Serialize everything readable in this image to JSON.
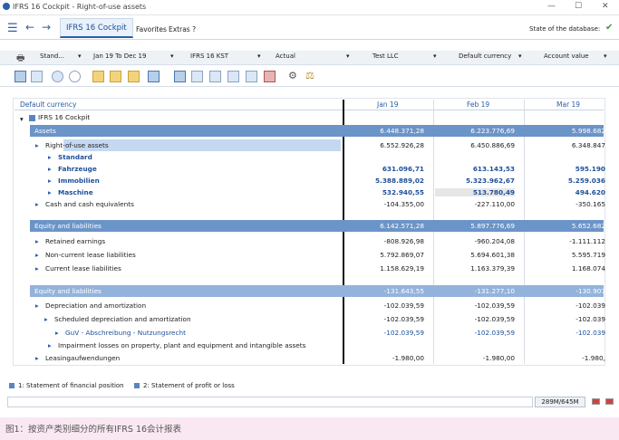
{
  "window": {
    "title": "IFRS 16 Cockpit - Right-of-use assets"
  },
  "menu": {
    "tab": "IFRS 16 Cockpit",
    "favorites": "Favorites",
    "extras": "Extras ?",
    "db_state": "State of the database:"
  },
  "params": [
    "Stand...",
    "Jan 19 To Dec 19",
    "IFRS 16 KST",
    "Actual",
    "Test LLC",
    "Default currency",
    "Account value"
  ],
  "grid": {
    "header": "Default currency",
    "columns": [
      "Jan 19",
      "Feb 19",
      "Mar 19"
    ],
    "root": "IFRS 16 Cockpit",
    "rows": [
      {
        "id": "assets",
        "label": "Assets",
        "values": [
          "6.448.371,28",
          "6.223.776,69",
          "5.998.682"
        ],
        "style": "band"
      },
      {
        "id": "rou",
        "label": "Right-of-use assets",
        "values": [
          "6.552.926,28",
          "6.450.886,69",
          "6.348.847"
        ],
        "style": "sel"
      },
      {
        "id": "standard",
        "label": "Standard",
        "values": [
          "",
          "",
          ""
        ],
        "style": "b"
      },
      {
        "id": "fahrzeuge",
        "label": "Fahrzeuge",
        "values": [
          "631.096,71",
          "613.143,53",
          "595.190"
        ],
        "style": "b"
      },
      {
        "id": "immobilien",
        "label": "Immobilien",
        "values": [
          "5.388.889,02",
          "5.323.962,67",
          "5.259.036"
        ],
        "style": "b"
      },
      {
        "id": "maschine",
        "label": "Maschine",
        "values": [
          "532.940,55",
          "513.780,49",
          "494.620"
        ],
        "style": "b"
      },
      {
        "id": "cash",
        "label": "Cash and cash equivalents",
        "values": [
          "-104.355,00",
          "-227.110,00",
          "-350.165"
        ],
        "style": "n"
      },
      {
        "id": "equity",
        "label": "Equity and liabilities",
        "values": [
          "6.142.571,28",
          "5.897.776,69",
          "5.652.682"
        ],
        "style": "band"
      },
      {
        "id": "retained",
        "label": "Retained earnings",
        "values": [
          "-808.926,98",
          "-960.204,08",
          "-1.111.112"
        ],
        "style": "n"
      },
      {
        "id": "noncurrent",
        "label": "Non-current lease liabilities",
        "values": [
          "5.792.869,07",
          "5.694.601,38",
          "5.595.719"
        ],
        "style": "n"
      },
      {
        "id": "current",
        "label": "Current lease liabilities",
        "values": [
          "1.158.629,19",
          "1.163.379,39",
          "1.168.074"
        ],
        "style": "n"
      },
      {
        "id": "equity2",
        "label": "Equity and liabilities",
        "values": [
          "-131.643,55",
          "-131.277,10",
          "-130.907"
        ],
        "style": "band2"
      },
      {
        "id": "depr",
        "label": "Depreciation and amortization",
        "values": [
          "-102.039,59",
          "-102.039,59",
          "-102.039"
        ],
        "style": "n"
      },
      {
        "id": "sched",
        "label": "Scheduled depreciation and amortization",
        "values": [
          "-102.039,59",
          "-102.039,59",
          "-102.039"
        ],
        "style": "n"
      },
      {
        "id": "guv",
        "label": "GuV - Abschreibung - Nutzungsrecht",
        "values": [
          "-102.039,59",
          "-102.039,59",
          "-102.039"
        ],
        "style": "link"
      },
      {
        "id": "impair",
        "label": "Impairment losses on property, plant and equipment and intangible assets",
        "values": [
          "",
          "",
          ""
        ],
        "style": "n"
      },
      {
        "id": "leasing",
        "label": "Leasingaufwendungen",
        "values": [
          "-1.980,00",
          "-1.980,00",
          "-1.980,"
        ],
        "style": "n"
      }
    ]
  },
  "legend": [
    "1: Statement of financial position",
    "2: Statement of profit or loss"
  ],
  "status": {
    "memory": "289M/645M"
  },
  "caption": "图1：按资产类别细分的所有IFRS 16会计报表"
}
